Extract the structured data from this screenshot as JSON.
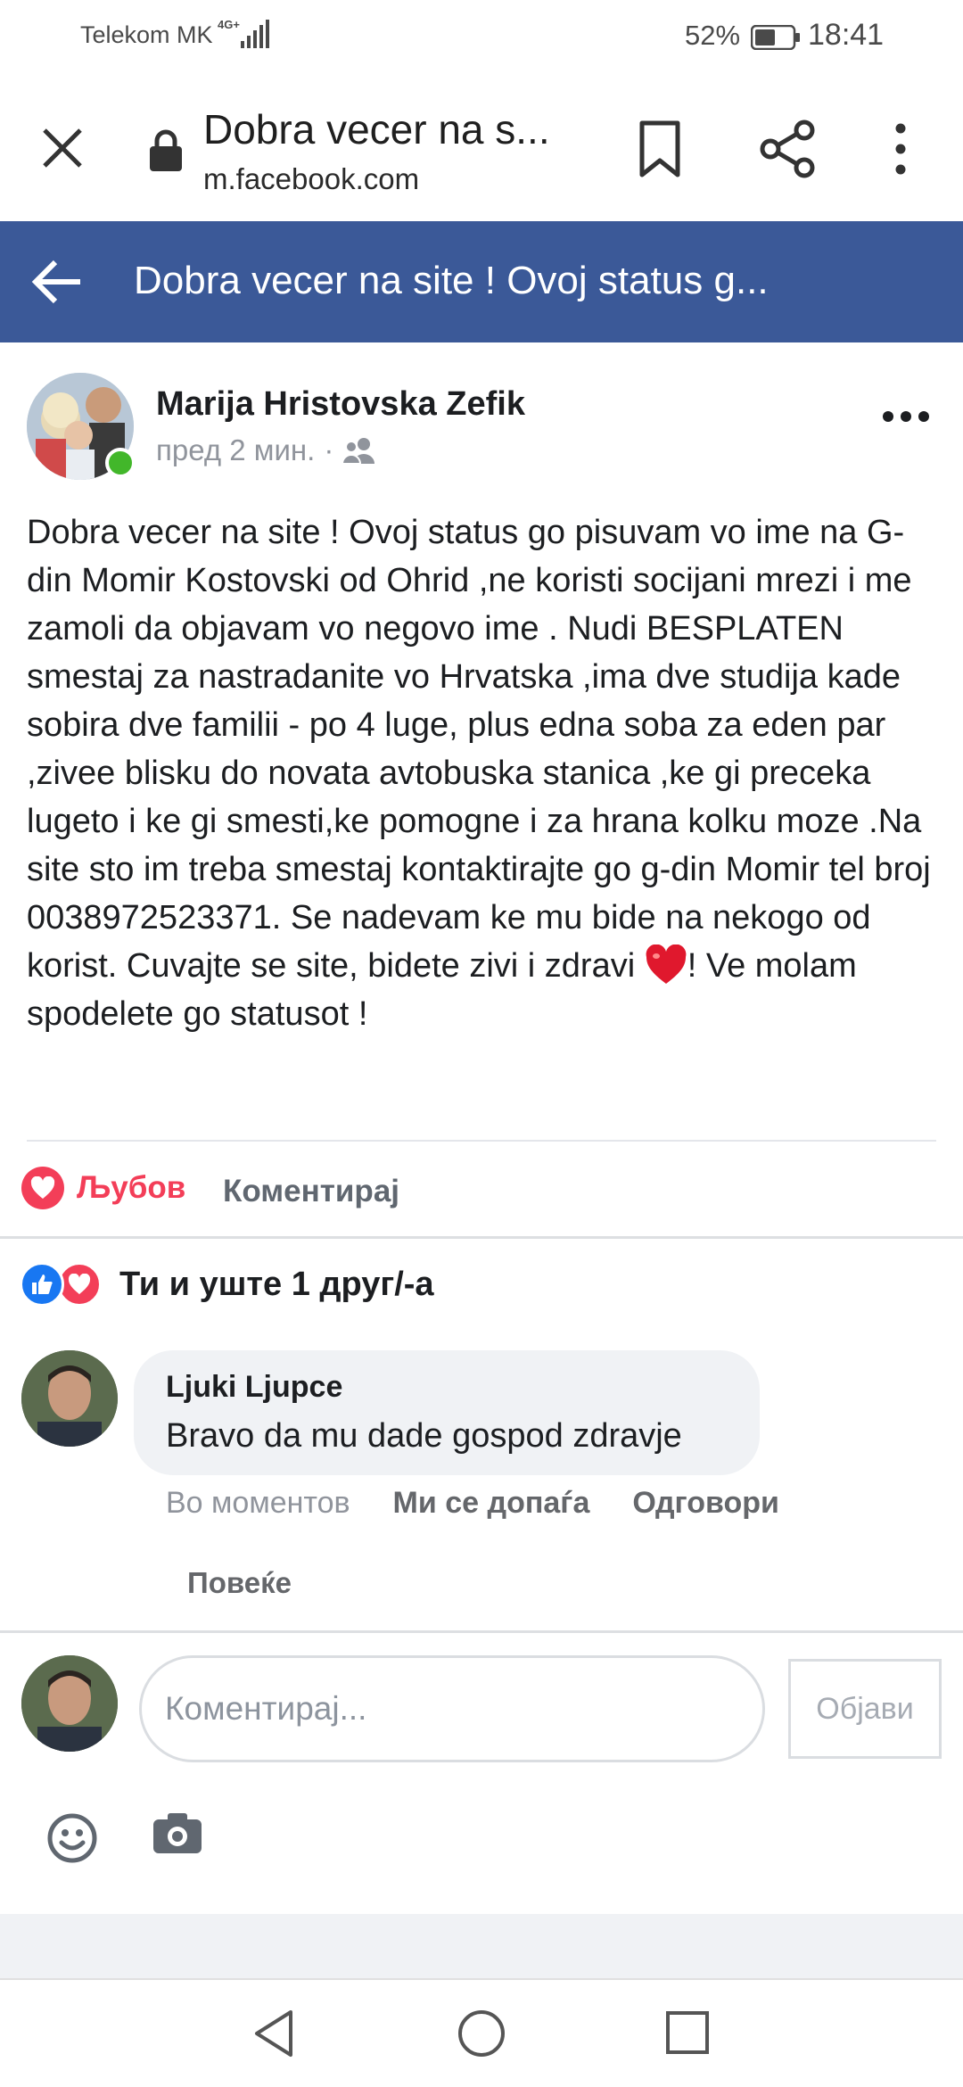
{
  "status_bar": {
    "carrier": "Telekom MK",
    "network": "4G+",
    "battery": "52%",
    "time": "18:41"
  },
  "browser": {
    "page_title": "Dobra vecer na s...",
    "url": "m.facebook.com"
  },
  "fb_header": {
    "title": "Dobra vecer na site ! Ovoj status g..."
  },
  "post": {
    "author": "Marija Hristovska Zefik",
    "time": "пред 2 мин.",
    "separator": "·",
    "audience_icon": "friends-icon",
    "text_before_emoji": "Dobra vecer na site ! Ovoj status go pisuvam vo ime na G-din Momir Kostovski od Ohrid ,ne koristi socijani mrezi i me zamoli da objavam vo negovo ime . Nudi BESPLATEN smestaj za nastradanite vo Hrvatska ,ima dve studija kade sobira dve familii - po 4 luge, plus edna soba za eden par ,zivee blisku do novata avtobuska stanica ,ke gi preceka lugeto i ke gi smesti,ke pomogne i za hrana kolku moze .Na site sto im treba smestaj kontaktirajte go g-din Momir tel broj 0038972523371. Se nadevam ke mu bide na nekogo od korist. Cuvajte se site, bidete zivi i zdravi ",
    "emoji": "red-heart",
    "text_after_emoji": "! Ve molam spodelete go statusot !"
  },
  "actions": {
    "love_label": "Љубов",
    "comment_label": "Коментирај"
  },
  "reactions": {
    "summary": "Ти и уште 1 друг/-а"
  },
  "comment": {
    "author": "Ljuki Ljupce",
    "text": "Bravo da mu dade gospod zdravje",
    "time": "Во моментов",
    "like_label": "Ми се допаѓа",
    "reply_label": "Одговори",
    "more_label": "Повеќе"
  },
  "compose": {
    "placeholder": "Коментирај...",
    "post_label": "Објави"
  },
  "colors": {
    "fb_blue": "#3b5998",
    "love_red": "#f33e58",
    "like_blue": "#1877f2",
    "online_green": "#42b72a"
  }
}
